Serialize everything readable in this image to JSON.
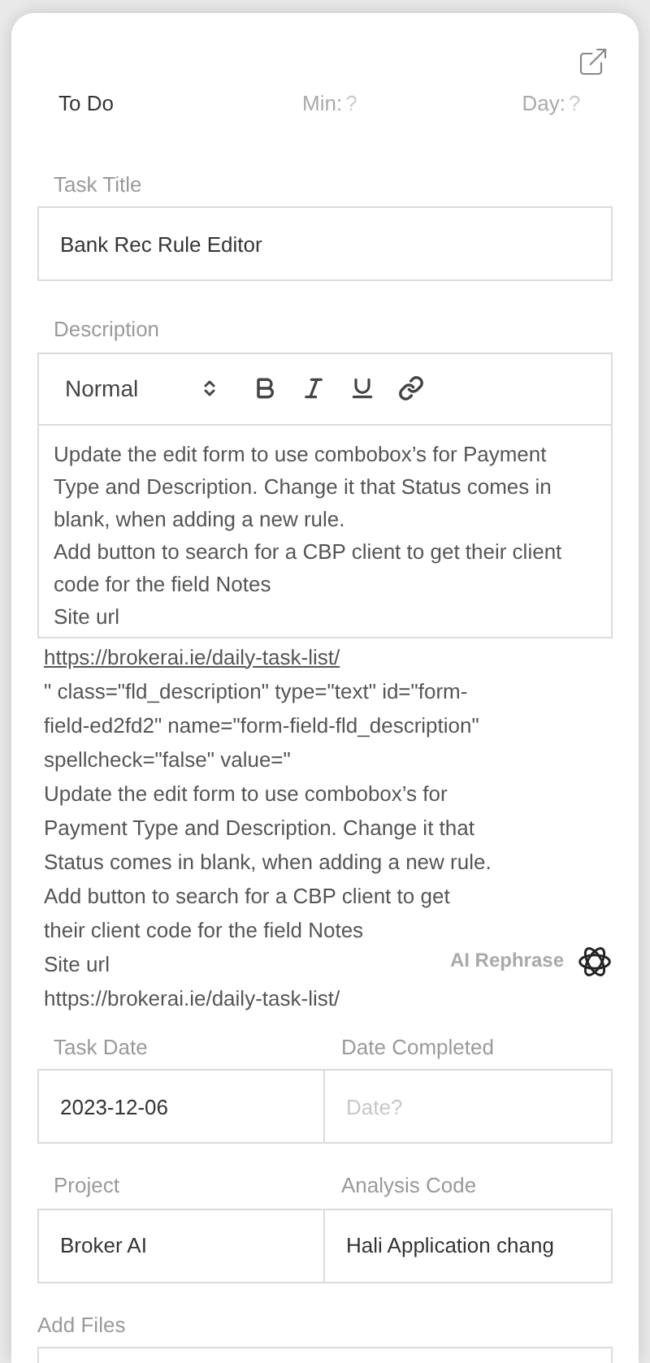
{
  "header": {
    "status": "To Do",
    "min": {
      "label": "Min:",
      "placeholder": "?"
    },
    "day": {
      "label": "Day:",
      "placeholder": "?"
    }
  },
  "task_title": {
    "label": "Task Title",
    "value": "Bank Rec Rule Editor"
  },
  "description": {
    "label": "Description",
    "format": "Normal",
    "paragraphs": [
      "Update the edit form to use combobox’s for Payment Type and Description. Change it that Status comes in blank, when adding a new rule.",
      "Add button to search for a CBP client to get their client code for the field Notes",
      "Site url"
    ],
    "overflow": [
      {
        "kind": "link",
        "text": "https://brokerai.ie/daily-task-list/"
      },
      {
        "kind": "text",
        "text": "\" class=\"fld_description\" type=\"text\" id=\"form-field-ed2fd2\" name=\"form-field-fld_description\" spellcheck=\"false\" value=\""
      },
      {
        "kind": "text",
        "text": "Update the edit form to use combobox’s for Payment Type and Description. Change it that Status comes in blank, when adding a new rule."
      },
      {
        "kind": "text",
        "text": "Add button to search for a CBP client to get their client code for the field Notes"
      },
      {
        "kind": "text",
        "text": "Site url"
      },
      {
        "kind": "text",
        "text": "https://brokerai.ie/daily-task-list/"
      }
    ],
    "rephrase": "AI Rephrase"
  },
  "task_date": {
    "label": "Task Date",
    "value": "2023-12-06"
  },
  "date_completed": {
    "label": "Date Completed",
    "placeholder": "Date?"
  },
  "project": {
    "label": "Project",
    "value": "Broker AI"
  },
  "analysis_code": {
    "label": "Analysis Code",
    "value": "Hali Application chang"
  },
  "add_files": {
    "label": "Add Files"
  }
}
